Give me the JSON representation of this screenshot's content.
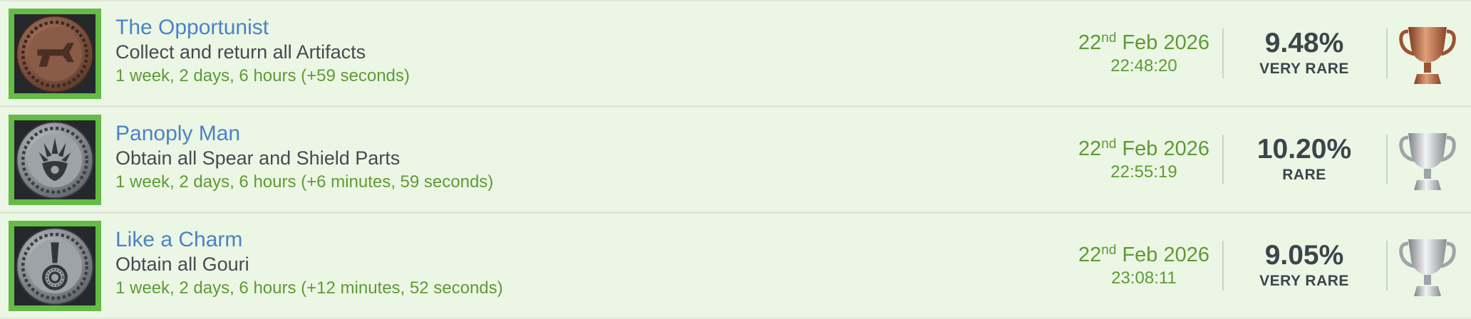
{
  "trophies": [
    {
      "title": "The Opportunist",
      "description": "Collect and return all Artifacts",
      "time": "1 week, 2 days, 6 hours (+59 seconds)",
      "date_day": "22",
      "date_suffix": "nd",
      "date_rest": " Feb 2026",
      "time_of_day": "22:48:20",
      "percent": "9.48%",
      "rarity": "VERY RARE",
      "trophy_type": "bronze",
      "badge_icon": "hammer-emblem-icon"
    },
    {
      "title": "Panoply Man",
      "description": "Obtain all Spear and Shield Parts",
      "time": "1 week, 2 days, 6 hours (+6 minutes, 59 seconds)",
      "date_day": "22",
      "date_suffix": "nd",
      "date_rest": " Feb 2026",
      "time_of_day": "22:55:19",
      "percent": "10.20%",
      "rarity": "RARE",
      "trophy_type": "silver",
      "badge_icon": "spear-shield-icon"
    },
    {
      "title": "Like a Charm",
      "description": "Obtain all Gouri",
      "time": "1 week, 2 days, 6 hours (+12 minutes, 52 seconds)",
      "date_day": "22",
      "date_suffix": "nd",
      "date_rest": " Feb 2026",
      "time_of_day": "23:08:11",
      "percent": "9.05%",
      "rarity": "VERY RARE",
      "trophy_type": "silver",
      "badge_icon": "charm-icon"
    }
  ],
  "colors": {
    "badge_border": "#64bb46",
    "title": "#4b82c7",
    "date": "#5d9b34",
    "bronze": "#b8693f",
    "silver": "#b9bdc0"
  }
}
